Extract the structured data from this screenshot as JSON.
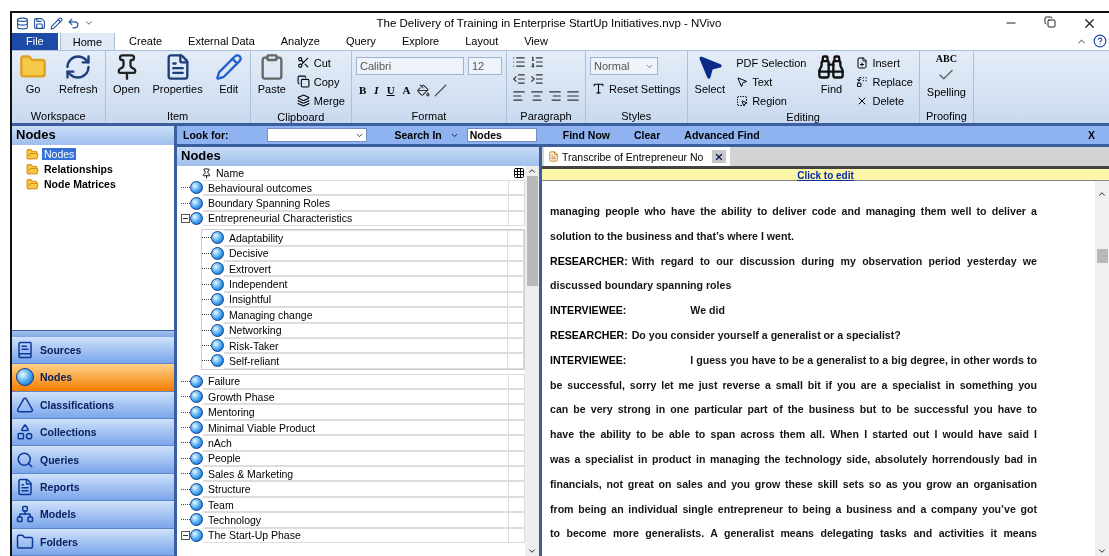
{
  "window": {
    "title": "The Delivery of Training in Enterprise StartUp Initiatives.nvp - NVivo"
  },
  "ribbon_tabs": [
    {
      "label": "File",
      "kind": "file",
      "selected": false
    },
    {
      "label": "Home",
      "kind": "tab",
      "selected": true
    },
    {
      "label": "Create",
      "kind": "tab",
      "selected": false
    },
    {
      "label": "External Data",
      "kind": "tab",
      "selected": false
    },
    {
      "label": "Analyze",
      "kind": "tab",
      "selected": false
    },
    {
      "label": "Query",
      "kind": "tab",
      "selected": false
    },
    {
      "label": "Explore",
      "kind": "tab",
      "selected": false
    },
    {
      "label": "Layout",
      "kind": "tab",
      "selected": false
    },
    {
      "label": "View",
      "kind": "tab",
      "selected": false
    }
  ],
  "ribbon": {
    "workspace": {
      "label": "Workspace",
      "go": "Go",
      "refresh": "Refresh"
    },
    "item": {
      "label": "Item",
      "open": "Open",
      "properties": "Properties",
      "edit": "Edit"
    },
    "clipboard": {
      "label": "Clipboard",
      "paste": "Paste",
      "cut": "Cut",
      "copy": "Copy",
      "merge": "Merge"
    },
    "format": {
      "label": "Format",
      "font": "Calibri",
      "size": "12",
      "bold": "B",
      "italic": "I",
      "underline": "U",
      "text_color": "A"
    },
    "paragraph": {
      "label": "Paragraph"
    },
    "styles": {
      "label": "Styles",
      "style": "Normal",
      "reset": "Reset Settings"
    },
    "editing": {
      "label": "Editing",
      "select": "Select",
      "pdf_selection": "PDF Selection",
      "text": "Text",
      "region": "Region",
      "find": "Find",
      "insert": "Insert",
      "replace": "Replace",
      "delete": "Delete"
    },
    "proofing": {
      "label": "Proofing",
      "abc": "ABC",
      "spelling": "Spelling"
    }
  },
  "navigation": {
    "title": "Nodes",
    "tree": [
      {
        "label": "Nodes",
        "selected": true
      },
      {
        "label": "Relationships",
        "selected": false
      },
      {
        "label": "Node Matrices",
        "selected": false
      }
    ],
    "buttons": [
      {
        "label": "Sources",
        "selected": false
      },
      {
        "label": "Nodes",
        "selected": true
      },
      {
        "label": "Classifications",
        "selected": false
      },
      {
        "label": "Collections",
        "selected": false
      },
      {
        "label": "Queries",
        "selected": false
      },
      {
        "label": "Reports",
        "selected": false
      },
      {
        "label": "Models",
        "selected": false
      },
      {
        "label": "Folders",
        "selected": false
      }
    ]
  },
  "find_bar": {
    "look_for": "Look for:",
    "search_in": "Search In",
    "search_in_value": "Nodes",
    "find_now": "Find Now",
    "clear": "Clear",
    "advanced_find": "Advanced Find",
    "close": "X"
  },
  "node_list": {
    "title": "Nodes",
    "column": "Name",
    "nodes": [
      {
        "name": "Behavioural outcomes"
      },
      {
        "name": "Boundary Spanning Roles"
      },
      {
        "name": "Entrepreneurial Characteristics",
        "expanded": true,
        "children": [
          {
            "name": "Adaptability"
          },
          {
            "name": "Decisive"
          },
          {
            "name": "Extrovert"
          },
          {
            "name": "Independent"
          },
          {
            "name": "Insightful"
          },
          {
            "name": "Managing change"
          },
          {
            "name": "Networking"
          },
          {
            "name": "Risk-Taker"
          },
          {
            "name": "Self-reliant"
          }
        ]
      },
      {
        "name": "Failure"
      },
      {
        "name": "Growth Phase"
      },
      {
        "name": "Mentoring"
      },
      {
        "name": "Minimal Viable Product"
      },
      {
        "name": "nAch"
      },
      {
        "name": "People"
      },
      {
        "name": "Sales & Marketing"
      },
      {
        "name": "Structure"
      },
      {
        "name": "Team"
      },
      {
        "name": "Technology"
      },
      {
        "name": "The Start-Up Phase",
        "expanded": true
      }
    ]
  },
  "document": {
    "tab": "Transcribe of Entrepreneur No",
    "edit_link": "Click to edit",
    "lines": [
      {
        "text": "managing people who have the ability to deliver code and managing them well to deliver a",
        "full": true
      },
      {
        "text": "solution to the business and that’s where I went.",
        "full": false
      },
      {
        "speaker": "RESEARCHER:",
        "text": "With regard to our discussion during my observation period yesterday we",
        "full": true
      },
      {
        "text": "discussed boundary spanning roles",
        "full": false
      },
      {
        "speaker": "INTERVIEWEE:",
        "text": "We did",
        "full": false
      },
      {
        "speaker": "RESEARCHER:",
        "text": "Do you consider yourself a generalist or a specialist?",
        "full": false
      },
      {
        "speaker": "INTERVIEWEE:",
        "text": "I guess you have to be a generalist to a big degree, in other words to",
        "full": true
      },
      {
        "text": "be successful, sorry let me just reverse a small bit if you are a specialist in something you",
        "full": true
      },
      {
        "text": "can be very strong in one particular part of the business but to be successful you have to",
        "full": true
      },
      {
        "text": "have the ability to be able to span across them all. When I started out I would have said I",
        "full": true
      },
      {
        "text": "was a specialist in product in managing the technology side, absolutely horrendously bad in",
        "full": true
      },
      {
        "text": "financials, not great on sales and you grow these skill sets so as you grow an organisation",
        "full": true
      },
      {
        "text": "from being an individual single entrepreneur to being a business and a company you’ve got",
        "full": true
      },
      {
        "text": "to become more generalists. A generalist means delegating tasks and activities it means",
        "full": true
      }
    ]
  }
}
